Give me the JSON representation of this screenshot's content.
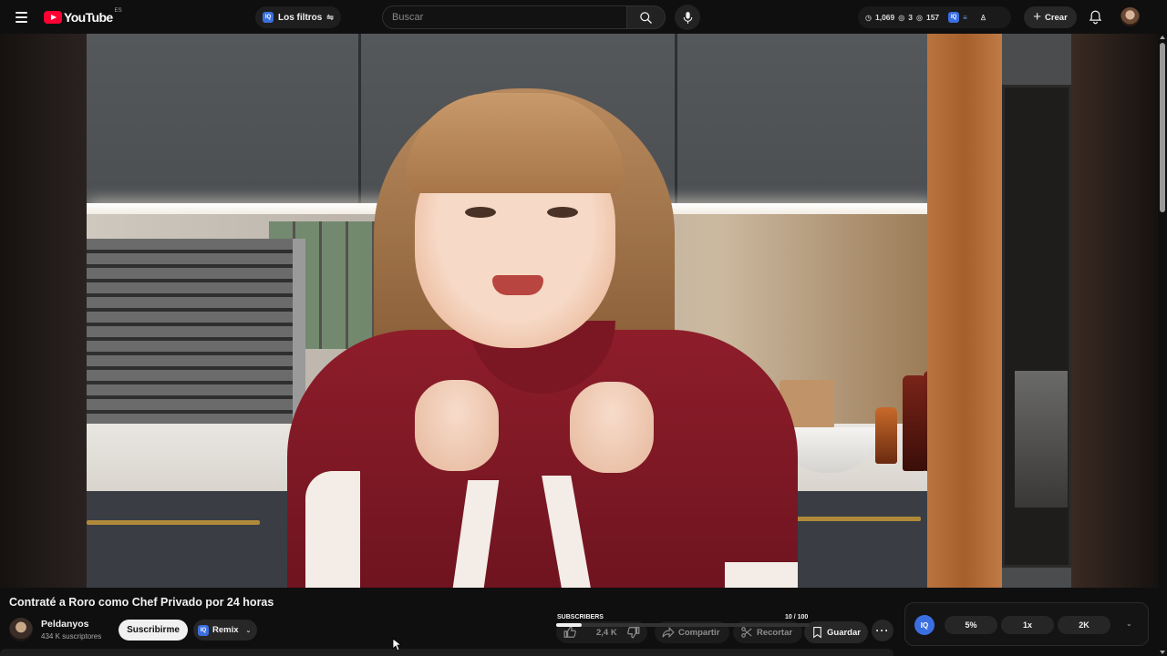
{
  "header": {
    "logo_text": "YouTube",
    "country_code": "ES",
    "filters_label": "Los filtros",
    "search_placeholder": "Buscar",
    "stats": [
      {
        "icon": "clock-icon",
        "value": "1,069"
      },
      {
        "icon": "eye-icon",
        "value": "3"
      },
      {
        "icon": "eye-icon",
        "value": "157"
      }
    ],
    "create_label": "Crear"
  },
  "video": {
    "title": "Contraté a Roro como Chef Privado por 24 horas"
  },
  "channel": {
    "name": "Peldanyos",
    "subscribers": "434 K suscriptores",
    "subscribe_label": "Suscribirme",
    "remix_label": "Remix"
  },
  "actions": {
    "subscribers_label": "SUBSCRIBERS",
    "subscribers_progress": "10  / 100",
    "progress_value": 0.1,
    "like_count": "2,4 K",
    "share_label": "Compartir",
    "clip_label": "Recortar",
    "save_label": "Guardar"
  },
  "speed_panel": {
    "badge": "IQ",
    "options": [
      "5%",
      "1x",
      "2K"
    ]
  },
  "colors": {
    "background": "#0f0f0f",
    "brand_red": "#ff0033",
    "iq_blue": "#3b6fe0"
  }
}
